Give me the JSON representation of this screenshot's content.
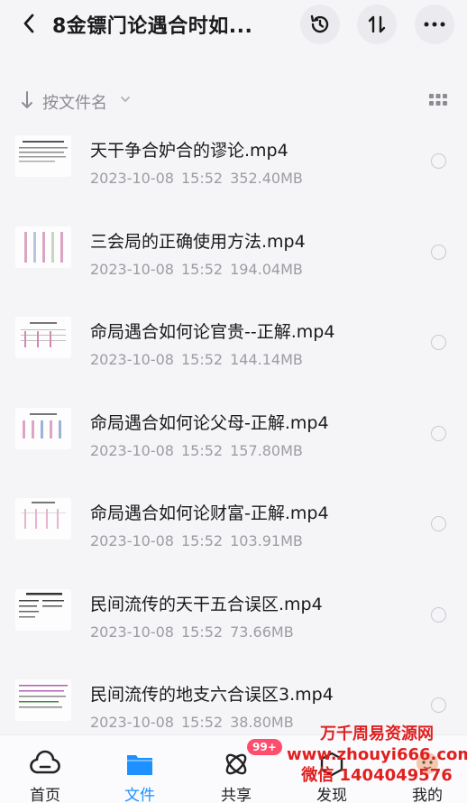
{
  "header": {
    "title": "8金镖门论遇合时如...",
    "back_icon": "chevron-left-icon",
    "history_icon": "history-icon",
    "sort_icon": "sort-toggle-icon",
    "more_icon": "more-dots-icon"
  },
  "sortbar": {
    "label": "按文件名",
    "arrow_icon": "arrow-down-icon",
    "chevron_icon": "chevron-down-icon",
    "view_icon": "grid-view-icon"
  },
  "files": [
    {
      "name": "天干争合妒合的谬论.mp4",
      "date": "2023-10-08",
      "time": "15:52",
      "size": "352.40MB"
    },
    {
      "name": "三会局的正确使用方法.mp4",
      "date": "2023-10-08",
      "time": "15:52",
      "size": "194.04MB"
    },
    {
      "name": "命局遇合如何论官贵--正解.mp4",
      "date": "2023-10-08",
      "time": "15:52",
      "size": "144.14MB"
    },
    {
      "name": "命局遇合如何论父母-正解.mp4",
      "date": "2023-10-08",
      "time": "15:52",
      "size": "157.80MB"
    },
    {
      "name": "命局遇合如何论财富-正解.mp4",
      "date": "2023-10-08",
      "time": "15:52",
      "size": "103.91MB"
    },
    {
      "name": "民间流传的天干五合误区.mp4",
      "date": "2023-10-08",
      "time": "15:52",
      "size": "73.66MB"
    },
    {
      "name": "民间流传的地支六合误区3.mp4",
      "date": "2023-10-08",
      "time": "15:52",
      "size": "38.80MB"
    }
  ],
  "nav": {
    "home": "首页",
    "files": "文件",
    "share": "共享",
    "share_badge": "99+",
    "discover": "发现",
    "mine": "我的",
    "active_color": "#1e90ff"
  },
  "watermark": {
    "line1": "万千周易资源网",
    "line2": "www.zhouyi666.com",
    "line3": "微信 1404049576"
  }
}
